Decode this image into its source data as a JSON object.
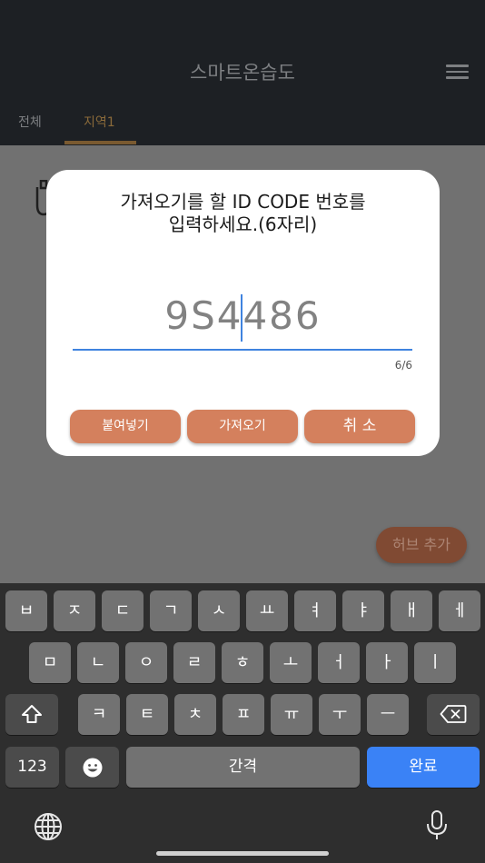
{
  "app": {
    "title": "스마트온습도"
  },
  "tabs": [
    {
      "label": "전체"
    },
    {
      "label": "지역1"
    }
  ],
  "hub_add_label": "허브 추가",
  "dialog": {
    "message_line1": "가져오기를 할 ID CODE 번호를",
    "message_line2": "입력하세요.(6자리)",
    "code_value": "9S4486",
    "counter": "6/6",
    "buttons": {
      "paste": "붙여넣기",
      "import": "가져오기",
      "cancel": "취 소"
    }
  },
  "keyboard": {
    "row1": [
      "ㅂ",
      "ㅈ",
      "ㄷ",
      "ㄱ",
      "ㅅ",
      "ㅛ",
      "ㅕ",
      "ㅑ",
      "ㅐ",
      "ㅔ"
    ],
    "row2": [
      "ㅁ",
      "ㄴ",
      "ㅇ",
      "ㄹ",
      "ㅎ",
      "ㅗ",
      "ㅓ",
      "ㅏ",
      "ㅣ"
    ],
    "row3": [
      "ㅋ",
      "ㅌ",
      "ㅊ",
      "ㅍ",
      "ㅠ",
      "ㅜ",
      "ㅡ"
    ],
    "numbers_label": "123",
    "space_label": "간격",
    "done_label": "완료",
    "icons": {
      "shift": "shift-icon",
      "backspace": "backspace-icon",
      "emoji": "emoji-icon",
      "globe": "globe-icon",
      "mic": "mic-icon"
    }
  },
  "colors": {
    "accent": "#d4805d",
    "focus": "#3f83df",
    "done_key": "#3a82f6"
  }
}
